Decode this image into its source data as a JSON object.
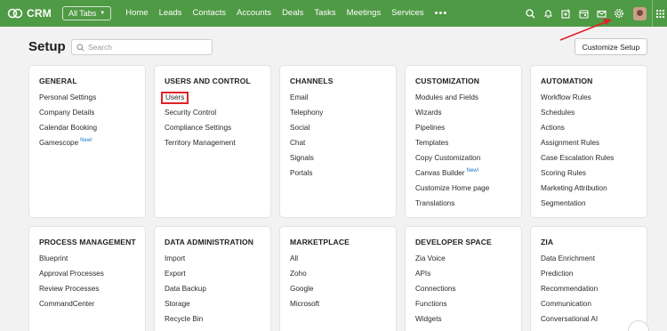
{
  "topbar": {
    "app_name": "CRM",
    "all_tabs_label": "All Tabs",
    "nav": [
      "Home",
      "Leads",
      "Contacts",
      "Accounts",
      "Deals",
      "Tasks",
      "Meetings",
      "Services"
    ],
    "more_label": "•••",
    "icons": [
      "search-icon",
      "bell-icon",
      "add-icon",
      "calendar-icon",
      "mail-icon",
      "gear-icon",
      "avatar",
      "apps-grid-icon"
    ],
    "bar_color": "#4f9a45"
  },
  "header": {
    "title": "Setup",
    "search_placeholder": "Search",
    "customize_label": "Customize Setup"
  },
  "annotation": {
    "color": "#e0222a",
    "highlighted_item": "Users"
  },
  "sections": [
    {
      "title": "GENERAL",
      "items": [
        {
          "label": "Personal Settings"
        },
        {
          "label": "Company Details"
        },
        {
          "label": "Calendar Booking"
        },
        {
          "label": "Gamescope",
          "badge": "New!"
        }
      ]
    },
    {
      "title": "USERS AND CONTROL",
      "items": [
        {
          "label": "Users",
          "highlighted": true
        },
        {
          "label": "Security Control"
        },
        {
          "label": "Compliance Settings"
        },
        {
          "label": "Territory Management"
        }
      ]
    },
    {
      "title": "CHANNELS",
      "items": [
        {
          "label": "Email"
        },
        {
          "label": "Telephony"
        },
        {
          "label": "Social"
        },
        {
          "label": "Chat"
        },
        {
          "label": "Signals"
        },
        {
          "label": "Portals"
        }
      ]
    },
    {
      "title": "CUSTOMIZATION",
      "items": [
        {
          "label": "Modules and Fields"
        },
        {
          "label": "Wizards"
        },
        {
          "label": "Pipelines"
        },
        {
          "label": "Templates"
        },
        {
          "label": "Copy Customization"
        },
        {
          "label": "Canvas Builder",
          "badge": "New!"
        },
        {
          "label": "Customize Home page"
        },
        {
          "label": "Translations"
        }
      ]
    },
    {
      "title": "AUTOMATION",
      "items": [
        {
          "label": "Workflow Rules"
        },
        {
          "label": "Schedules"
        },
        {
          "label": "Actions"
        },
        {
          "label": "Assignment Rules"
        },
        {
          "label": "Case Escalation Rules"
        },
        {
          "label": "Scoring Rules"
        },
        {
          "label": "Marketing Attribution"
        },
        {
          "label": "Segmentation"
        }
      ]
    },
    {
      "title": "PROCESS MANAGEMENT",
      "items": [
        {
          "label": "Blueprint"
        },
        {
          "label": "Approval Processes"
        },
        {
          "label": "Review Processes"
        },
        {
          "label": "CommandCenter"
        }
      ]
    },
    {
      "title": "DATA ADMINISTRATION",
      "items": [
        {
          "label": "Import"
        },
        {
          "label": "Export"
        },
        {
          "label": "Data Backup"
        },
        {
          "label": "Storage"
        },
        {
          "label": "Recycle Bin"
        }
      ]
    },
    {
      "title": "MARKETPLACE",
      "items": [
        {
          "label": "All"
        },
        {
          "label": "Zoho"
        },
        {
          "label": "Google"
        },
        {
          "label": "Microsoft"
        }
      ]
    },
    {
      "title": "DEVELOPER SPACE",
      "items": [
        {
          "label": "Zia Voice"
        },
        {
          "label": "APIs"
        },
        {
          "label": "Connections"
        },
        {
          "label": "Functions"
        },
        {
          "label": "Widgets"
        }
      ]
    },
    {
      "title": "ZIA",
      "items": [
        {
          "label": "Data Enrichment"
        },
        {
          "label": "Prediction"
        },
        {
          "label": "Recommendation"
        },
        {
          "label": "Communication"
        },
        {
          "label": "Conversational AI"
        }
      ]
    }
  ]
}
